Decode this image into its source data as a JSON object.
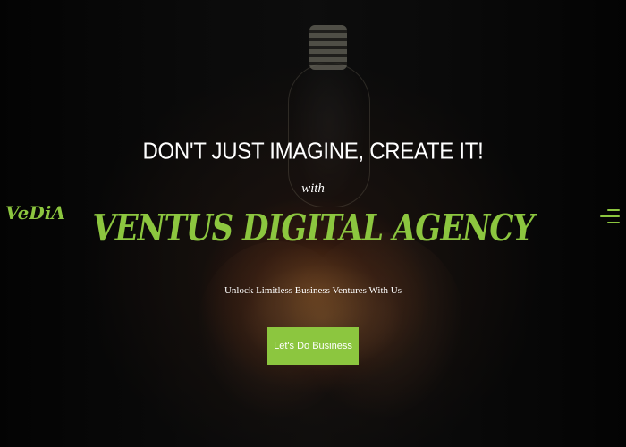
{
  "header": {
    "logo_text": "VeDiA",
    "menu_icon": "hamburger-menu-icon"
  },
  "hero": {
    "headline": "DON'T JUST IMAGINE, CREATE IT!",
    "with": "with",
    "agency_name": "VENTUS DIGITAL AGENCY",
    "tagline": "Unlock Limitless Business Ventures With Us",
    "cta_label": "Let's Do Business"
  },
  "colors": {
    "accent": "#8cc63f",
    "text": "#ffffff",
    "background": "#0b0b0b"
  }
}
